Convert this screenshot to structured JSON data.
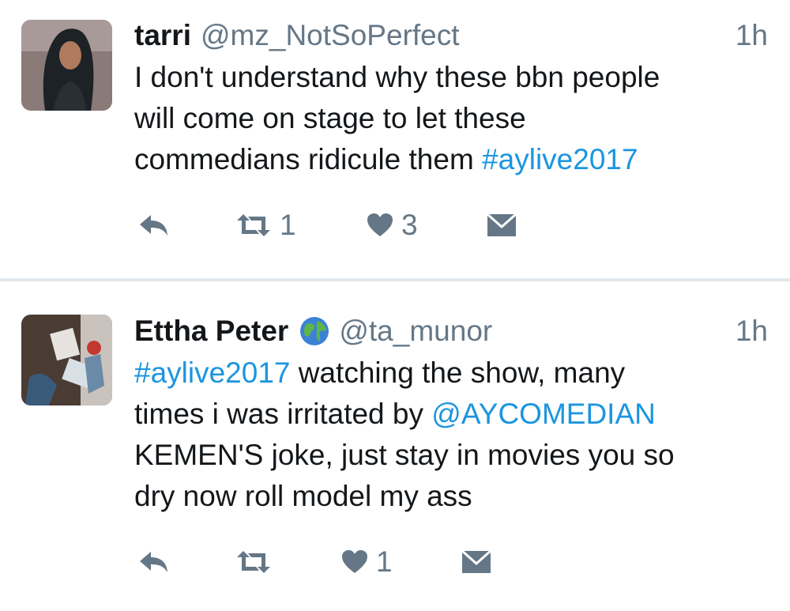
{
  "colors": {
    "link": "#1b95e0",
    "muted": "#657786",
    "text": "#14171a",
    "divider": "#e1e8ed"
  },
  "tweets": [
    {
      "name": "tarri",
      "handle": "@mz_NotSoPerfect",
      "time": "1h",
      "verified_icon": "",
      "lines": [
        {
          "segments": [
            {
              "text": "I don't understand why these bbn people",
              "link": false
            }
          ]
        },
        {
          "segments": [
            {
              "text": "will come on stage to let these",
              "link": false
            }
          ]
        },
        {
          "segments": [
            {
              "text": "commedians ridicule them ",
              "link": false
            },
            {
              "text": "#aylive2017",
              "link": true
            }
          ]
        }
      ],
      "retweets": "1",
      "likes": "3"
    },
    {
      "name": "Ettha Peter",
      "handle": "@ta_munor",
      "time": "1h",
      "name_emoji": "globe-icon",
      "lines": [
        {
          "segments": [
            {
              "text": "#aylive2017",
              "link": true
            },
            {
              "text": " watching the show, many",
              "link": false
            }
          ]
        },
        {
          "segments": [
            {
              "text": "times i was irritated by ",
              "link": false
            },
            {
              "text": "@AYCOMEDIAN",
              "link": true
            }
          ]
        },
        {
          "segments": [
            {
              "text": "KEMEN'S joke, just stay in movies you so",
              "link": false
            }
          ]
        },
        {
          "segments": [
            {
              "text": "dry now roll model my ass",
              "link": false
            }
          ]
        }
      ],
      "retweets": "",
      "likes": "1"
    }
  ]
}
